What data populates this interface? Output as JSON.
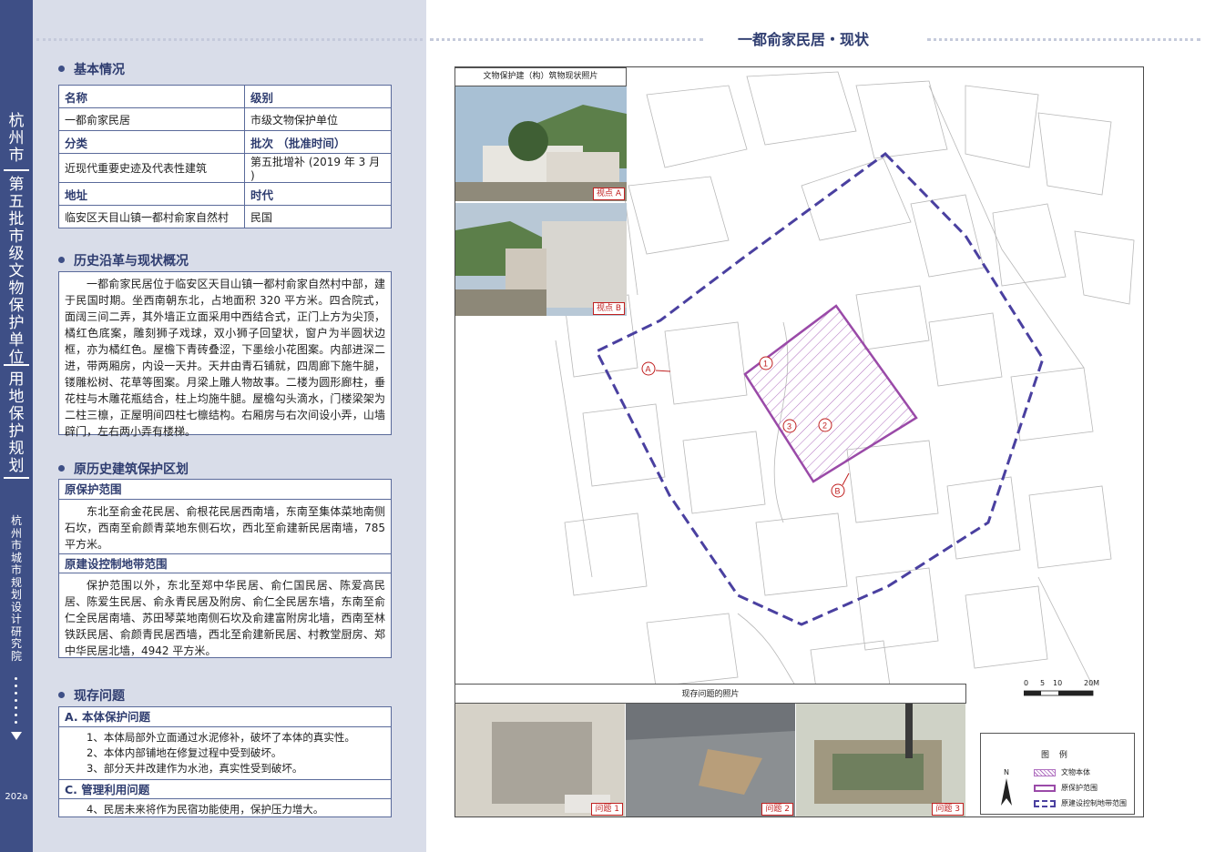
{
  "sidebar": {
    "title_city": "杭州市",
    "title_units": "第五批市级文物保护单位",
    "title_plan": "用地保护规划",
    "institute": "杭州市城市规划设计研究院",
    "page_number": "202a"
  },
  "basic": {
    "title": "基本情况",
    "name_label": "名称",
    "level_label": "级别",
    "name": "一都俞家民居",
    "level": "市级文物保护单位",
    "category_label": "分类",
    "batch_label": "批次 （批准时间）",
    "category": "近现代重要史迹及代表性建筑",
    "batch": "第五批增补 (2019 年 3 月 )",
    "address_label": "地址",
    "era_label": "时代",
    "address": "临安区天目山镇一都村俞家自然村",
    "era": "民国"
  },
  "history": {
    "title": "历史沿革与现状概况",
    "text": "一都俞家民居位于临安区天目山镇一都村俞家自然村中部，建于民国时期。坐西南朝东北，占地面积 320 平方米。四合院式，面阔三间二弄，其外墙正立面采用中西结合式，正门上方为尖顶，橘红色底案，雕刻狮子戏球，双小狮子回望状，窗户为半圆状边框，亦为橘红色。屋檐下青砖叠涩，下墨绘小花图案。内部进深二进，带两厢房，内设一天井。天井由青石铺就，四周廊下施牛腿，镂雕松树、花草等图案。月梁上雕人物故事。二楼为圆形廊柱，垂花柱与木雕花瓶结合，柱上均施牛腿。屋檐勾头滴水，门楼梁架为二柱三檩，正屋明间四柱七檩结构。右厢房与右次间设小弄，山墙辟门，左右两小弄有楼梯。"
  },
  "zoning": {
    "title": "原历史建筑保护区划",
    "protect_label": "原保护范围",
    "protect_text": "东北至俞金花民居、俞根花民居西南墙，东南至集体菜地南侧石坎，西南至俞颜青菜地东侧石坎，西北至俞建新民居南墙，785 平方米。",
    "control_label": "原建设控制地带范围",
    "control_text": "保护范围以外，东北至郑中华民居、俞仁国民居、陈爱高民居、陈爱生民居、俞永青民居及附房、俞仁全民居东墙，东南至俞仁全民居南墙、苏田琴菜地南侧石坎及俞建富附房北墙，西南至林铁跃民居、俞颜青民居西墙，西北至俞建新民居、村教堂厨房、郑中华民居北墙，4942 平方米。"
  },
  "issues": {
    "title": "现存问题",
    "a_label": "A. 本体保护问题",
    "a_items": [
      "1、本体局部外立面通过水泥修补，破坏了本体的真实性。",
      "2、本体内部铺地在修复过程中受到破坏。",
      "3、部分天井改建作为水池，真实性受到破坏。"
    ],
    "c_label": "C. 管理利用问题",
    "c_items": [
      "4、民居未来将作为民宿功能使用，保护压力增大。"
    ]
  },
  "right": {
    "page_title": "一都俞家民居・现状",
    "photo_caption": "文物保护建（构）筑物现状照片",
    "view_a": "视点 A",
    "view_b": "视点 B",
    "problems_caption": "现存问题的照片",
    "problem_1": "问题 1",
    "problem_2": "问题 2",
    "problem_3": "问题 3",
    "map_marker_a": "A",
    "map_marker_b": "B",
    "map_marker_1": "1",
    "map_marker_2": "2",
    "map_marker_3": "3",
    "north": "N",
    "scale_labels": [
      "0",
      "5",
      "10",
      "20M"
    ],
    "legend": {
      "title": "图 例",
      "item_body": "文物本体",
      "item_protect": "原保护范围",
      "item_control": "原建设控制地带范围"
    }
  }
}
